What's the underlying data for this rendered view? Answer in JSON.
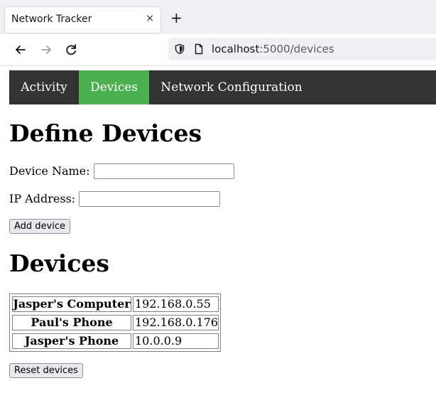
{
  "browser": {
    "tab_title": "Network Tracker",
    "tab_close_glyph": "×",
    "new_tab_glyph": "+",
    "url_host": "localhost",
    "url_path": ":5000/devices",
    "icons": [
      "back-arrow-icon",
      "forward-arrow-icon",
      "reload-icon",
      "shield-icon",
      "page-icon"
    ]
  },
  "nav": {
    "items": [
      {
        "label": "Activity",
        "active": false
      },
      {
        "label": "Devices",
        "active": true
      },
      {
        "label": "Network Configuration",
        "active": false
      }
    ],
    "active_color": "#4caf50",
    "bar_color": "#333333"
  },
  "define": {
    "title": "Define Devices",
    "name_label": "Device Name:",
    "name_value": "",
    "ip_label": "IP Address:",
    "ip_value": "",
    "add_button": "Add device"
  },
  "devices": {
    "title": "Devices",
    "rows": [
      {
        "name": "Jasper's Computer",
        "ip": "192.168.0.55"
      },
      {
        "name": "Paul's Phone",
        "ip": "192.168.0.176"
      },
      {
        "name": "Jasper's Phone",
        "ip": "10.0.0.9"
      }
    ],
    "reset_button": "Reset devices"
  }
}
